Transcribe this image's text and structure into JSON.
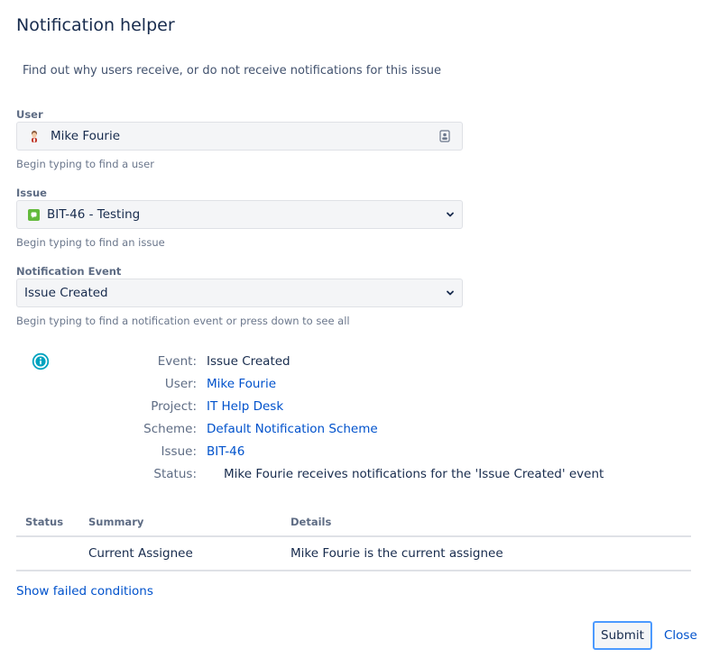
{
  "dialog": {
    "title": "Notification helper",
    "intro": "Find out why users receive, or do not receive notifications for this issue"
  },
  "fields": {
    "user": {
      "label": "User",
      "value": "Mike Fourie",
      "hint": "Begin typing to find a user"
    },
    "issue": {
      "label": "Issue",
      "value": "BIT-46 - Testing",
      "hint": "Begin typing to find an issue"
    },
    "event": {
      "label": "Notification Event",
      "value": "Issue Created",
      "hint": "Begin typing to find a notification event or press down to see all"
    }
  },
  "details": {
    "event_label": "Event:",
    "event_value": "Issue Created",
    "user_label": "User:",
    "user_value": "Mike Fourie",
    "project_label": "Project:",
    "project_value": "IT Help Desk",
    "scheme_label": "Scheme:",
    "scheme_value": "Default Notification Scheme",
    "issue_label": "Issue:",
    "issue_value": "BIT-46",
    "status_label": "Status:",
    "status_value": "Mike Fourie receives notifications for the 'Issue Created' event"
  },
  "table": {
    "headers": {
      "status": "Status",
      "summary": "Summary",
      "details": "Details"
    },
    "rows": [
      {
        "status": "",
        "summary": "Current Assignee",
        "details": "Mike Fourie is the current assignee"
      }
    ]
  },
  "links": {
    "show_failed": "Show failed conditions"
  },
  "buttons": {
    "submit": "Submit",
    "close": "Close"
  },
  "icons": {
    "user_avatar": "user-avatar-icon",
    "contact": "contact-card-icon",
    "issue_type": "story-icon",
    "dropdown": "chevron-down-icon",
    "info": "info-icon"
  },
  "colors": {
    "link": "#0052cc",
    "info": "#00a3bf",
    "issue_type": "#63ba3c",
    "focus": "#4c9aff"
  }
}
